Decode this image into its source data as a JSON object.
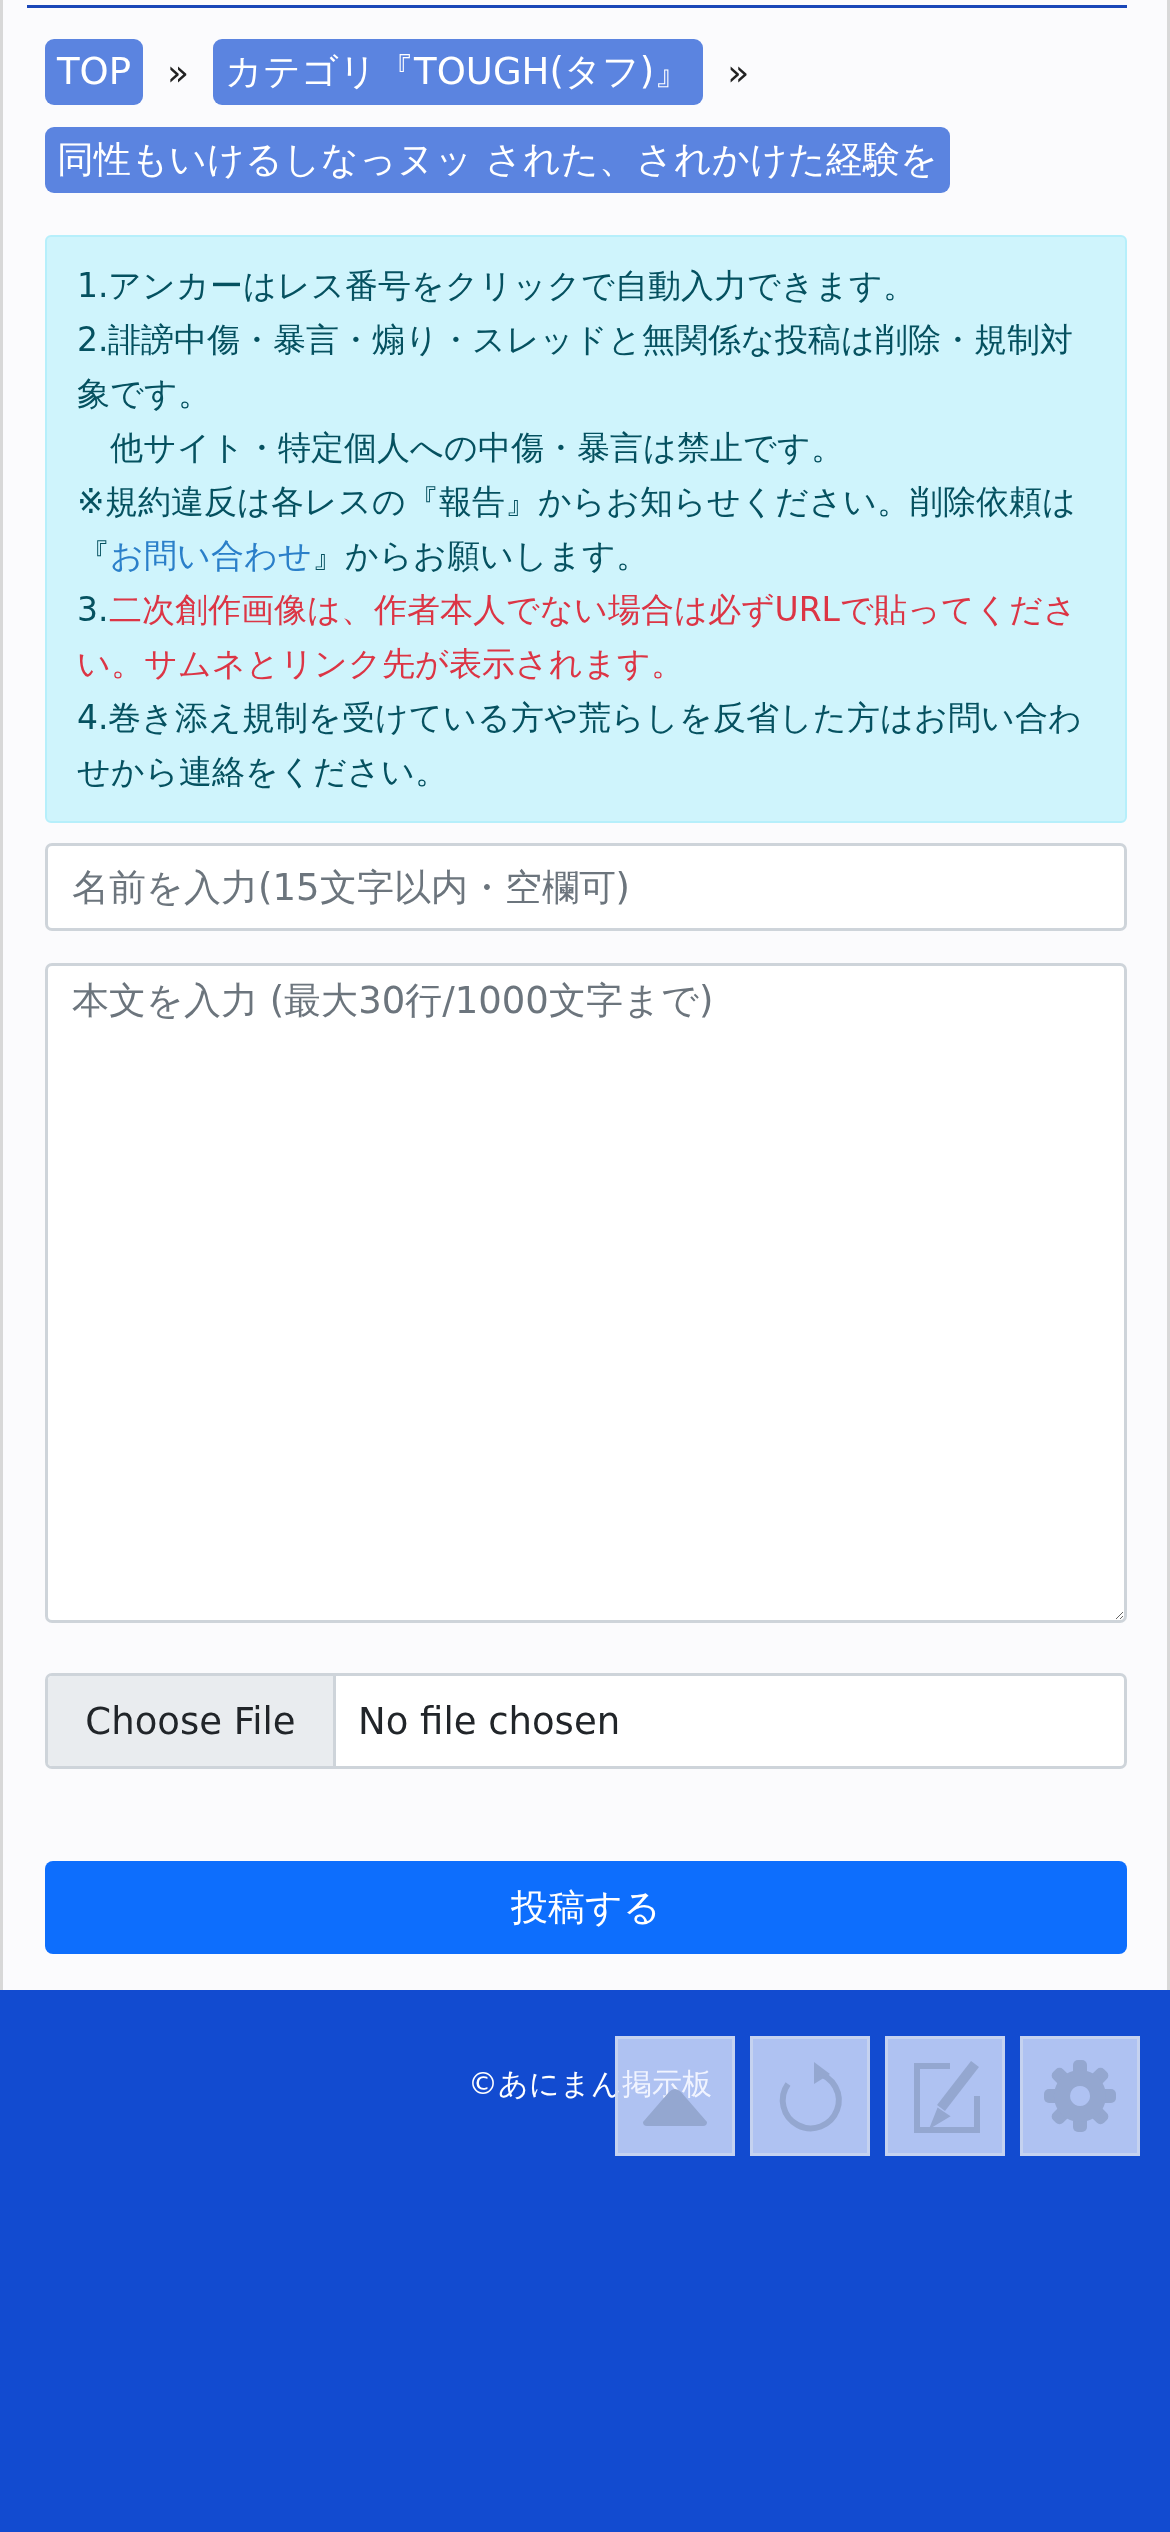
{
  "breadcrumb": [
    {
      "label": "TOP",
      "separator": "»"
    },
    {
      "label": "カテゴリ『TOUGH(タフ)』",
      "separator": "»"
    },
    {
      "label": "同性もいけるしなっヌッ された、されかけた経験を"
    }
  ],
  "notice": [
    {
      "segments": [
        {
          "kind": "text",
          "text": "1.アンカーはレス番号をクリックで自動入力できます。"
        }
      ]
    },
    {
      "segments": [
        {
          "kind": "text",
          "text": "2.誹謗中傷・暴言・煽り・スレッドと無関係な投稿は削除・規制対象です。"
        }
      ]
    },
    {
      "segments": [
        {
          "kind": "text",
          "text": "　他サイト・特定個人への中傷・暴言は禁止です。"
        }
      ]
    },
    {
      "segments": [
        {
          "kind": "text",
          "text": "※規約違反は各レスの『報告』からお知らせください。削除依頼は『"
        },
        {
          "kind": "link",
          "text": "お問い合わせ"
        },
        {
          "kind": "text",
          "text": "』からお願いします。"
        }
      ]
    },
    {
      "segments": [
        {
          "kind": "text",
          "text": "3."
        },
        {
          "kind": "warning",
          "text": "二次創作画像は、作者本人でない場合は必ずURLで貼ってください。サムネとリンク先が表示されます。"
        }
      ]
    },
    {
      "segments": [
        {
          "kind": "text",
          "text": "4.巻き添え規制を受けている方や荒らしを反省した方はお問い合わせから連絡をください。"
        }
      ]
    }
  ],
  "form": {
    "name_field": {
      "placeholder": "名前を入力(15文字以内・空欄可)"
    },
    "body_field": {
      "placeholder": "本文を入力 (最大30行/1000文字まで)"
    },
    "file_input": {
      "button": "Choose File",
      "status": "No file chosen"
    },
    "submit": "投稿する"
  },
  "footer": {
    "copyright": "©あにまん掲示板"
  },
  "floating_buttons": [
    {
      "kind": "up"
    },
    {
      "kind": "reload"
    },
    {
      "kind": "edit"
    },
    {
      "kind": "settings"
    }
  ]
}
